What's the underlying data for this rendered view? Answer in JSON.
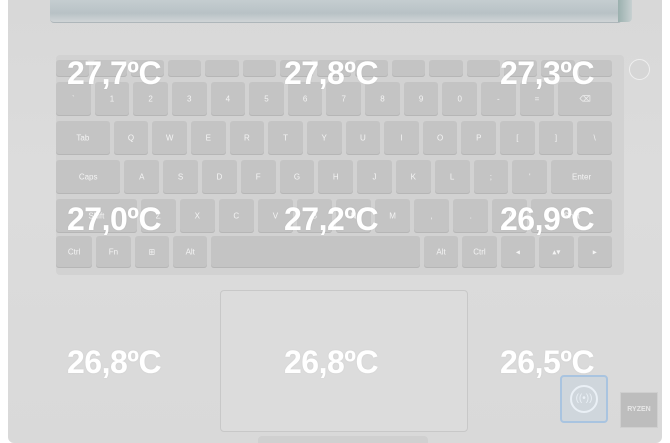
{
  "temperatures": [
    "27,7ºC",
    "27,8ºC",
    "27,3ºC",
    "27,0ºC",
    "27,2ºC",
    "26,9ºC",
    "26,8ºC",
    "26,8ºC",
    "26,5ºC"
  ],
  "keys": {
    "row1": [
      "`",
      "1",
      "2",
      "3",
      "4",
      "5",
      "6",
      "7",
      "8",
      "9",
      "0",
      "-",
      "=",
      "⌫"
    ],
    "row2": [
      "Tab",
      "Q",
      "W",
      "E",
      "R",
      "T",
      "Y",
      "U",
      "I",
      "O",
      "P",
      "[",
      "]",
      "\\"
    ],
    "row3": [
      "Caps",
      "A",
      "S",
      "D",
      "F",
      "G",
      "H",
      "J",
      "K",
      "L",
      ";",
      "'",
      "Enter"
    ],
    "row4": [
      "Shift",
      "Z",
      "X",
      "C",
      "V",
      "B",
      "N",
      "M",
      ",",
      ".",
      "/",
      "Shift"
    ],
    "row5": [
      "Ctrl",
      "Fn",
      "⊞",
      "Alt",
      "",
      "Alt",
      "Ctrl",
      "◂",
      "▴▾",
      "▸"
    ]
  },
  "badges": {
    "ryzen": "RYZEN",
    "nfc": "((•))"
  }
}
